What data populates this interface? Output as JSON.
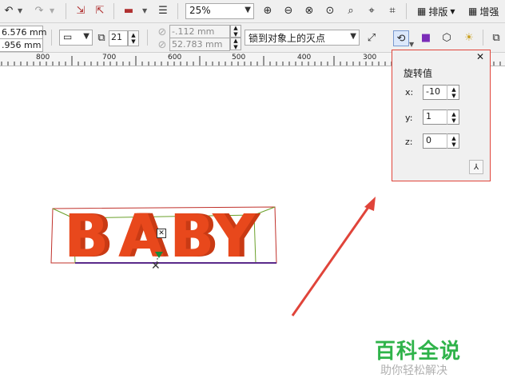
{
  "toolbar": {
    "zoom_value": "25%",
    "layout_menu_label": "排版",
    "enhance_menu_label": "增强"
  },
  "property_bar": {
    "width_value": "6.576 mm",
    "height_value": ".956 mm",
    "copies_value": "21",
    "offset_x_value": "-.112 mm",
    "offset_y_value": "52.783 mm",
    "vanishing_point_value": "锁到对象上的灭点"
  },
  "ruler": {
    "labels": [
      "800",
      "700",
      "600",
      "500",
      "400",
      "300"
    ]
  },
  "canvas": {
    "letters": [
      "B",
      "A",
      "B",
      "Y"
    ]
  },
  "rotation_panel": {
    "title": "旋转值",
    "x_label": "x:",
    "x_value": "-10",
    "y_label": "y:",
    "y_value": "1",
    "z_label": "z:",
    "z_value": "0",
    "close_symbol": "✕"
  },
  "watermark": {
    "title": "百科全说",
    "subtitle": "助你轻松解决"
  },
  "colors": {
    "accent_red": "#e0443a",
    "letter_orange": "#e8481c",
    "watermark_green": "#2fb34a"
  },
  "icons": [
    "undo-icon",
    "redo-icon",
    "import-icon",
    "export-icon",
    "publish-icon",
    "options-icon",
    "zoom-in-icon",
    "zoom-out-icon",
    "zoom-selected-icon",
    "zoom-all-icon",
    "zoom-page-icon",
    "zoom-width-icon",
    "layout-icon",
    "enhance-icon",
    "rotation-icon",
    "color-icon",
    "bevel-icon",
    "lighting-icon",
    "copy-extrude-icon"
  ]
}
